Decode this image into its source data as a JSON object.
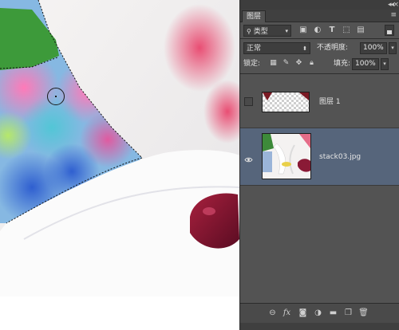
{
  "panel": {
    "title": "图层",
    "filter": {
      "kind_label": "类型"
    },
    "blend_mode": {
      "value": "正常"
    },
    "opacity": {
      "label": "不透明度:",
      "value": "100%"
    },
    "lock": {
      "label": "锁定:"
    },
    "fill": {
      "label": "填充:",
      "value": "100%"
    },
    "layers": [
      {
        "name": "图层 1",
        "visible": false,
        "selected": false
      },
      {
        "name": "stack03.jpg",
        "visible": true,
        "selected": true
      }
    ]
  },
  "colors": {
    "panel_bg": "#535353",
    "selected_layer": "#56657b",
    "field_bg": "#3e3e3e"
  }
}
